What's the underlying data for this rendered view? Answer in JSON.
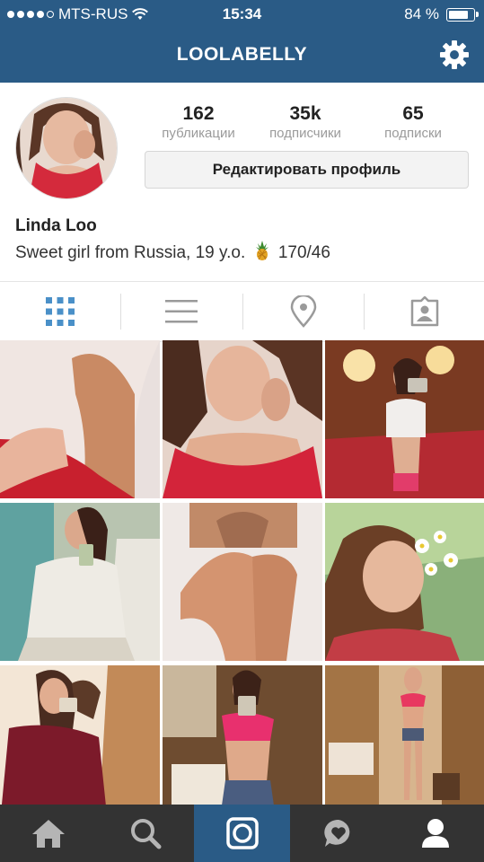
{
  "status_bar": {
    "carrier": "MTS-RUS",
    "time": "15:34",
    "battery": "84 %",
    "signal_bars": 4
  },
  "nav": {
    "title": "LOOLABELLY",
    "settings_icon": "gear-icon"
  },
  "profile": {
    "stats": [
      {
        "value": "162",
        "label": "публикации"
      },
      {
        "value": "35k",
        "label": "подписчики"
      },
      {
        "value": "65",
        "label": "подписки"
      }
    ],
    "edit_button": "Редактировать профиль",
    "name": "Linda Loo",
    "bio": "Sweet girl from Russia, 19 y.o.",
    "bio_emoji": "pineapple-emoji",
    "bio_suffix": "170/46"
  },
  "tabs": [
    {
      "id": "grid",
      "icon": "grid-icon",
      "active": true
    },
    {
      "id": "list",
      "icon": "list-icon",
      "active": false
    },
    {
      "id": "map",
      "icon": "location-pin-icon",
      "active": false
    },
    {
      "id": "tagged",
      "icon": "tagged-person-icon",
      "active": false
    }
  ],
  "photos": [
    {
      "subject": "legs-on-red-dress"
    },
    {
      "subject": "selfie-red-top"
    },
    {
      "subject": "mirror-selfie-bedroom"
    },
    {
      "subject": "mirror-selfie-towel"
    },
    {
      "subject": "bath-legs"
    },
    {
      "subject": "daisies-portrait"
    },
    {
      "subject": "couple-mirror-selfie"
    },
    {
      "subject": "mirror-selfie-pink-top"
    },
    {
      "subject": "full-length-mirror-selfie"
    }
  ],
  "tab_bar": [
    {
      "icon": "home-icon",
      "active": false
    },
    {
      "icon": "search-icon",
      "active": false
    },
    {
      "icon": "camera-icon",
      "active": true
    },
    {
      "icon": "activity-icon",
      "active": false
    },
    {
      "icon": "profile-icon",
      "active": false
    }
  ],
  "colors": {
    "header": "#2a5b86",
    "tab_bar": "#333333",
    "active_tab": "#4a90c8",
    "muted_text": "#9a9a9a"
  }
}
